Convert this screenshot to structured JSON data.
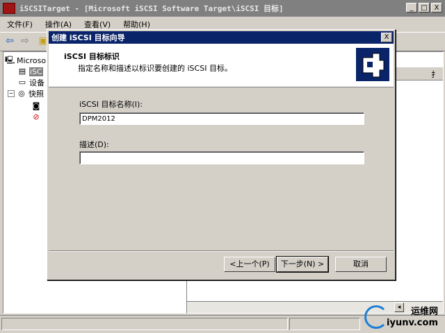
{
  "window": {
    "title": "iSCSITarget - [Microsoft iSCSI Software Target\\iSCSI 目标]",
    "minimize": "_",
    "maximize": "□",
    "close": "X"
  },
  "menu": [
    "文件(F)",
    "操作(A)",
    "查看(V)",
    "帮助(H)"
  ],
  "tree": {
    "items": [
      {
        "label": "Microso",
        "icon": "computer-icon"
      },
      {
        "label": "iSC",
        "icon": "target-icon"
      },
      {
        "label": "设备",
        "icon": "disk-icon"
      },
      {
        "label": "快照",
        "icon": "snapshot-icon"
      },
      {
        "label": "",
        "icon": "snapshot-item-icon"
      },
      {
        "label": "",
        "icon": "snapshot-error-icon"
      }
    ]
  },
  "right_pane": {
    "column_header": "扌"
  },
  "dialog": {
    "title": "创建 iSCSI 目标向导",
    "close": "X",
    "header_title": "iSCSI 目标标识",
    "header_subtitle": "指定名称和描述以标识要创建的 iSCSI 目标。",
    "name_label": "iSCSI 目标名称(I):",
    "name_value": "DPM2012",
    "desc_label": "描述(D):",
    "desc_value": "",
    "back_button": "<上一个(P)",
    "next_button": "下一步(N) >",
    "cancel_button": "取消"
  },
  "watermark": {
    "line1": "运维网",
    "line2": "iyunv.com"
  },
  "colors": {
    "dialog_title_bg": "#0a246a",
    "inactive_title_bg": "#808080",
    "face": "#d4d0c8"
  }
}
